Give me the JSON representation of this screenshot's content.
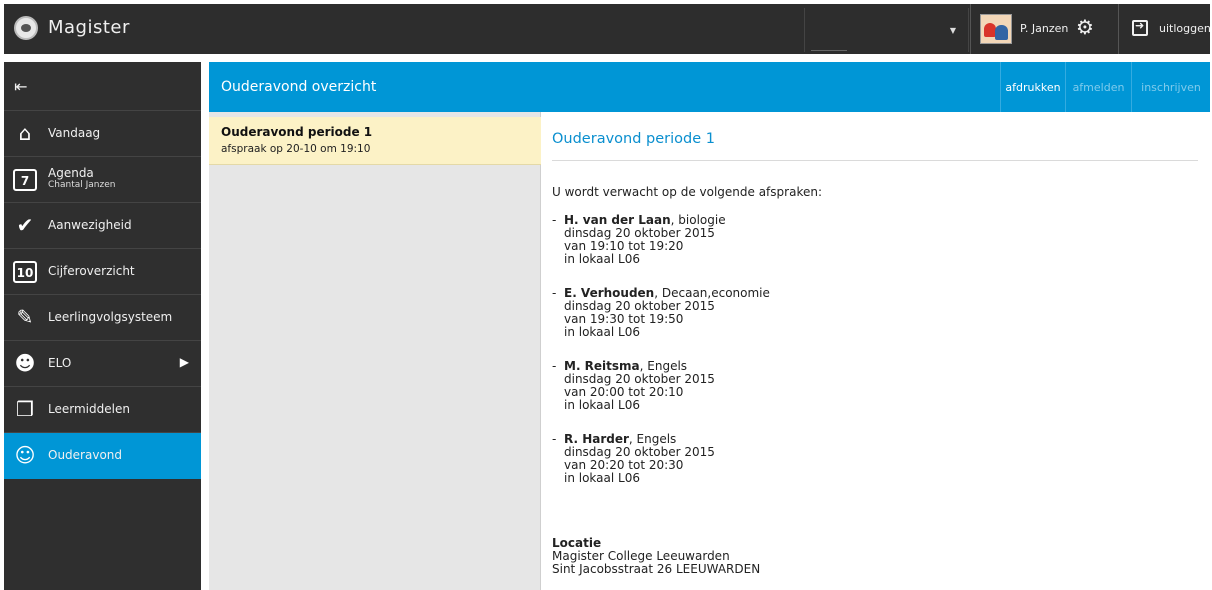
{
  "app": {
    "title": "Magister"
  },
  "topbar": {
    "user_name": "P. Janzen",
    "logout_label": "uitloggen"
  },
  "sidebar": {
    "items": [
      {
        "label": "Vandaag",
        "icon": "home-icon"
      },
      {
        "label": "Agenda",
        "sub": "Chantal Janzen",
        "icon": "calendar-icon",
        "icon_text": "7"
      },
      {
        "label": "Aanwezigheid",
        "icon": "checkmark-icon"
      },
      {
        "label": "Cijferoverzicht",
        "icon": "grades-icon",
        "icon_text": "10"
      },
      {
        "label": "Leerlingvolgsysteem",
        "icon": "notebook-icon"
      },
      {
        "label": "ELO",
        "icon": "people-icon"
      },
      {
        "label": "Leermiddelen",
        "icon": "books-icon"
      },
      {
        "label": "Ouderavond",
        "icon": "parent-meeting-icon",
        "active": true
      }
    ]
  },
  "header": {
    "title": "Ouderavond overzicht",
    "buttons": [
      {
        "label": "afdrukken",
        "enabled": true
      },
      {
        "label": "afmelden",
        "enabled": false
      },
      {
        "label": "inschrijven",
        "enabled": false
      }
    ]
  },
  "list": {
    "items": [
      {
        "title": "Ouderavond periode 1",
        "subtitle": "afspraak op 20-10 om 19:10"
      }
    ]
  },
  "detail": {
    "title": "Ouderavond periode 1",
    "intro": "U wordt verwacht op de volgende afspraken:",
    "appointments": [
      {
        "name": "H. van der Laan",
        "subject": ", biologie",
        "date": "dinsdag 20 oktober 2015",
        "time": "van 19:10 tot 19:20",
        "room": "in lokaal L06"
      },
      {
        "name": "E. Verhouden",
        "subject": ", Decaan,economie",
        "date": "dinsdag 20 oktober 2015",
        "time": "van 19:30 tot 19:50",
        "room": "in lokaal L06"
      },
      {
        "name": "M. Reitsma",
        "subject": ", Engels",
        "date": "dinsdag 20 oktober 2015",
        "time": "van 20:00 tot 20:10",
        "room": "in lokaal L06"
      },
      {
        "name": "R. Harder",
        "subject": ", Engels",
        "date": "dinsdag 20 oktober 2015",
        "time": "van 20:20 tot 20:30",
        "room": "in lokaal L06"
      }
    ],
    "location": {
      "title": "Locatie",
      "name": "Magister College Leeuwarden",
      "address": "Sint Jacobsstraat 26 LEEUWARDEN"
    }
  },
  "colors": {
    "accent": "#0096d6",
    "sidebar": "#2f2f2f",
    "topbar": "#2d2d2d",
    "selected_item": "#fcf2c6"
  }
}
